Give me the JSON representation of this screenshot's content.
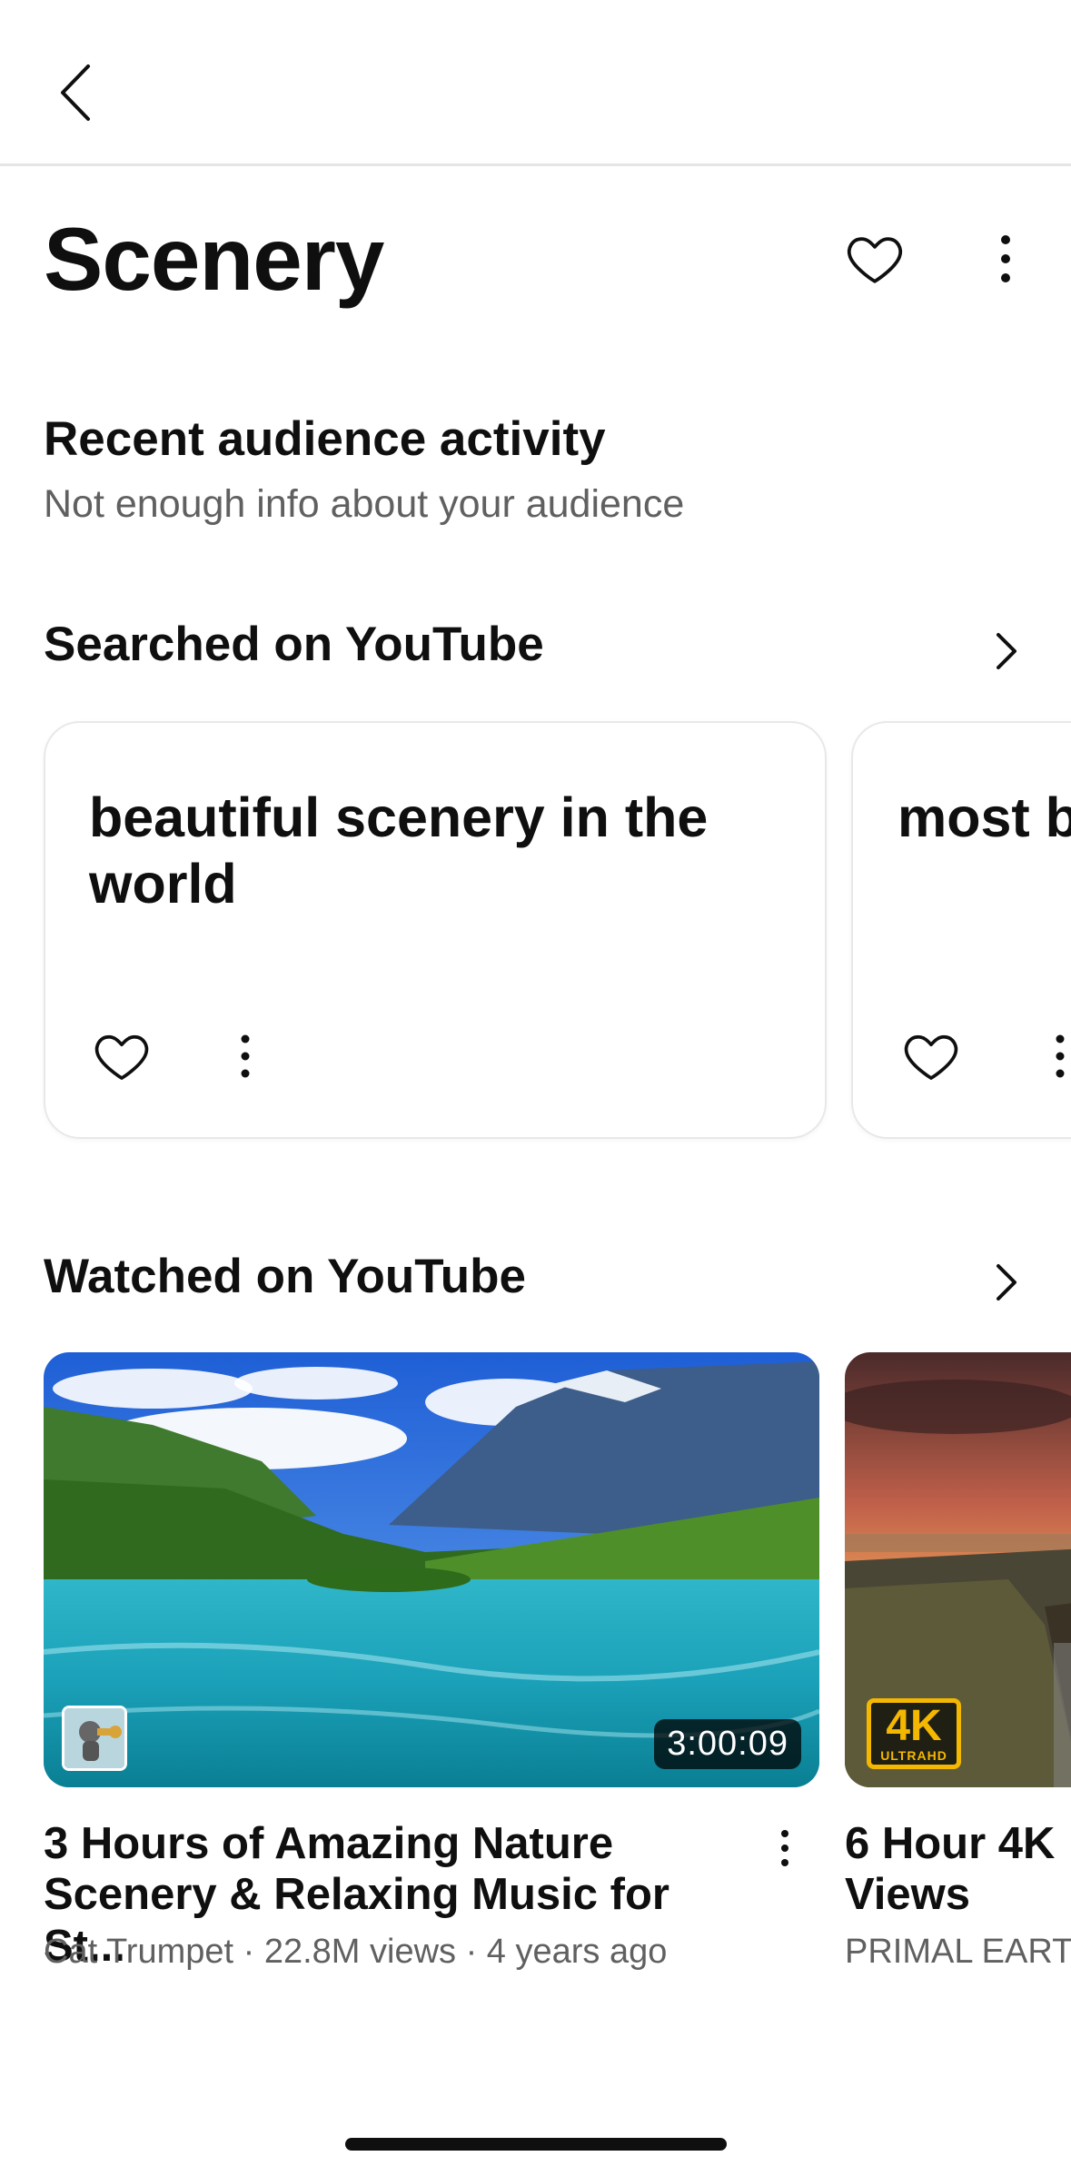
{
  "page": {
    "title": "Scenery"
  },
  "audience": {
    "heading": "Recent audience activity",
    "subtitle": "Not enough info about your audience"
  },
  "searched": {
    "heading": "Searched on YouTube",
    "cards": [
      {
        "query": "beautiful scenery in the world"
      },
      {
        "query": "most b… nature"
      }
    ]
  },
  "watched": {
    "heading": "Watched on YouTube",
    "videos": [
      {
        "title": "3 Hours of Amazing Nature Scenery & Relaxing Music for St...",
        "meta": "Cat Trumpet · 22.8M views · 4 years ago",
        "duration": "3:00:09"
      },
      {
        "title": "6 Hour 4K Views",
        "meta": "PRIMAL EARTH",
        "badge_big": "4K",
        "badge_small": "ULTRAHD"
      }
    ]
  },
  "colors": {
    "text": "#0f0f0f",
    "secondary": "#606060",
    "divider": "#e5e5e5"
  },
  "icons": [
    "back-arrow-icon",
    "heart-icon",
    "more-vert-icon",
    "chevron-right-icon"
  ]
}
